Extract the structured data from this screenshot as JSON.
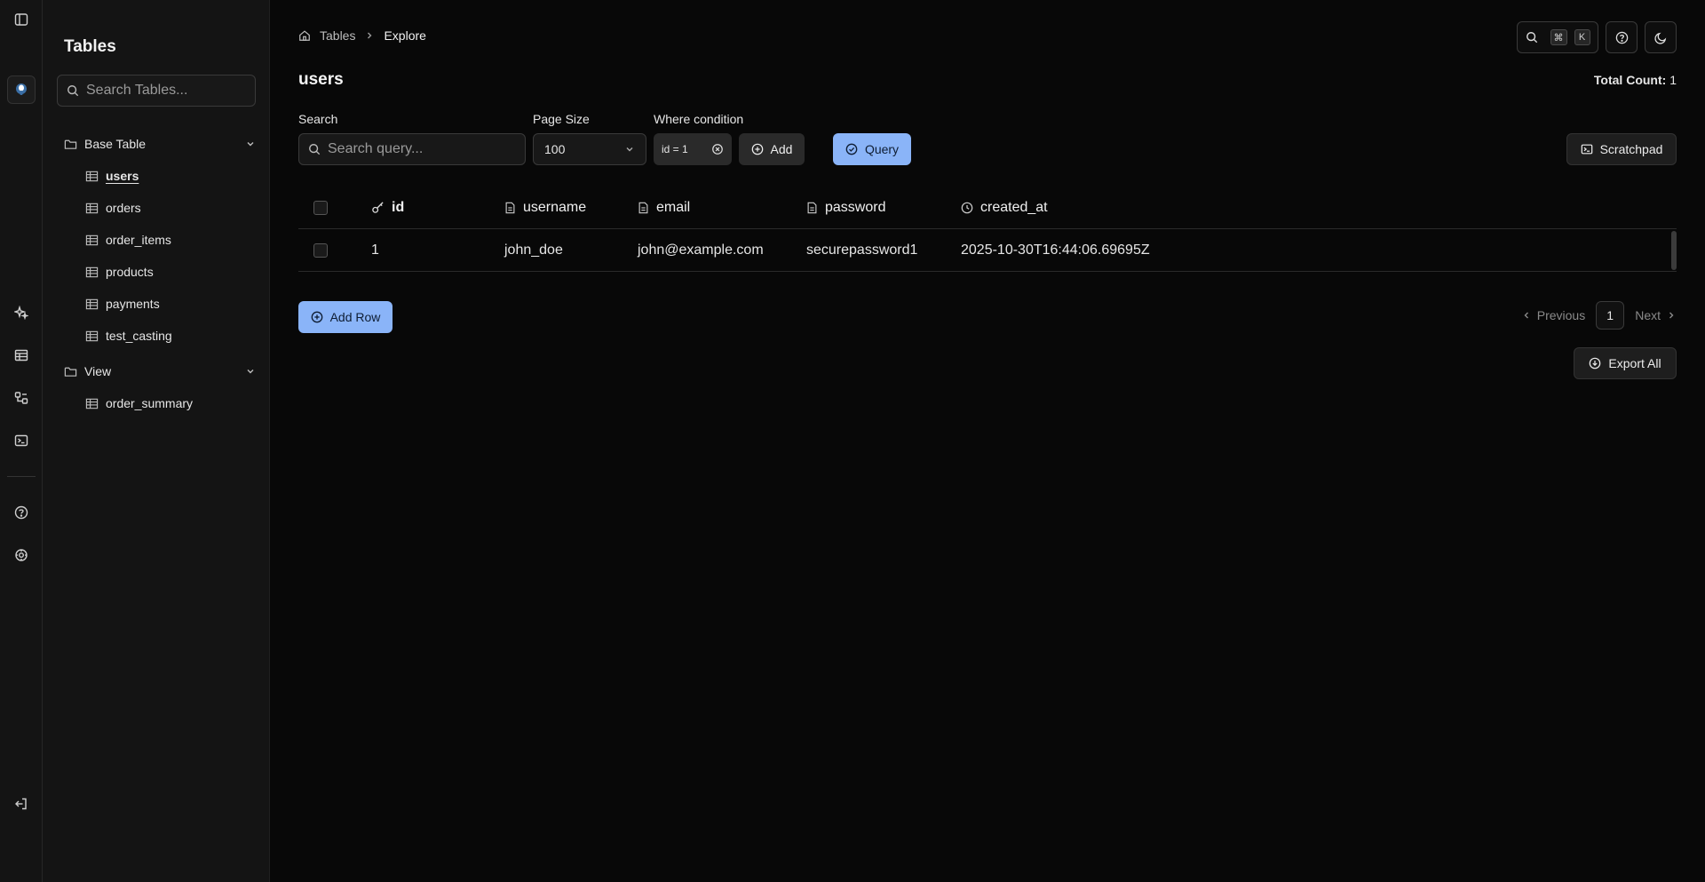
{
  "sidebar": {
    "title": "Tables",
    "search_placeholder": "Search Tables...",
    "groups": [
      {
        "label": "Base Table",
        "items": [
          "users",
          "orders",
          "order_items",
          "products",
          "payments",
          "test_casting"
        ]
      },
      {
        "label": "View",
        "items": [
          "order_summary"
        ]
      }
    ],
    "active_item": "users"
  },
  "breadcrumb": {
    "root": "Tables",
    "current": "Explore"
  },
  "header": {
    "kbd_modifier": "⌘",
    "kbd_key": "K"
  },
  "page": {
    "title": "users",
    "total_label": "Total Count:",
    "total_value": "1"
  },
  "filters": {
    "search_label": "Search",
    "search_placeholder": "Search query...",
    "page_size_label": "Page Size",
    "page_size_value": "100",
    "where_label": "Where condition",
    "where_chip": "id = 1",
    "add_label": "Add",
    "query_label": "Query",
    "scratchpad_label": "Scratchpad"
  },
  "table": {
    "columns": [
      "id",
      "username",
      "email",
      "password",
      "created_at"
    ],
    "rows": [
      [
        "1",
        "john_doe",
        "john@example.com",
        "securepassword1",
        "2025-10-30T16:44:06.69695Z"
      ]
    ]
  },
  "actions": {
    "add_row_label": "Add Row",
    "export_label": "Export All"
  },
  "pagination": {
    "previous": "Previous",
    "page": "1",
    "next": "Next"
  },
  "colors": {
    "accent": "#8ab4f8",
    "background": "#080808",
    "sidebar": "#141414"
  }
}
